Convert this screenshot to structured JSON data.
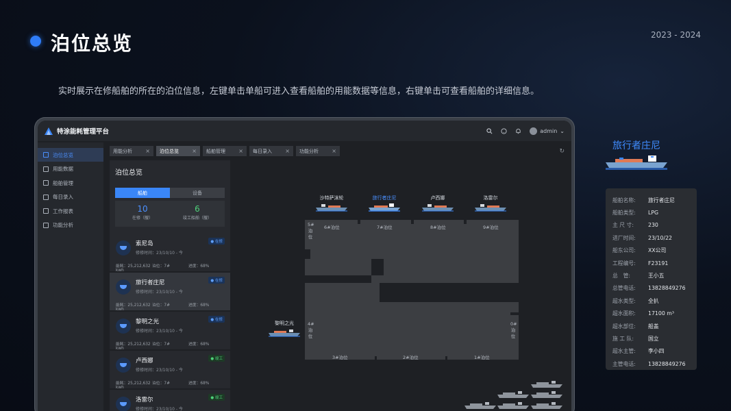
{
  "slide": {
    "title": "泊位总览",
    "year": "2023 - 2024",
    "description": "实时展示在修船舶的所在的泊位信息，左键单击单船可进入查看船舶的用能数据等信息，右键单击可查看船舶的详细信息。"
  },
  "app": {
    "name": "特涂能耗管理平台",
    "user": "admin"
  },
  "sidebar": {
    "items": [
      {
        "label": "泊位总览",
        "icon": "anchor-icon"
      },
      {
        "label": "用能数据",
        "icon": "chart-icon"
      },
      {
        "label": "船舶管理",
        "icon": "ship-icon"
      },
      {
        "label": "每日录入",
        "icon": "edit-icon"
      },
      {
        "label": "工作报表",
        "icon": "report-icon"
      },
      {
        "label": "功能分析",
        "icon": "monitor-icon"
      }
    ]
  },
  "tabs": [
    {
      "label": "用能分析"
    },
    {
      "label": "泊位总览"
    },
    {
      "label": "船舶管理"
    },
    {
      "label": "每日录入"
    },
    {
      "label": "功能分析"
    }
  ],
  "panel": {
    "title": "泊位总览",
    "seg_ship": "船舶",
    "seg_device": "设备",
    "stat_repair_value": "10",
    "stat_repair_label": "在修（艘）",
    "stat_done_value": "6",
    "stat_done_label": "竣工船舶（艘）",
    "ships": [
      {
        "name": "索尼岛",
        "time": "修修时间：23/10/10 - 今",
        "energy": "能耗：25,212,632 kwh",
        "berth": "泊位：7#",
        "progress": "进度：68%",
        "status": "在修"
      },
      {
        "name": "旅行者庄尼",
        "time": "修修时间：23/10/10 - 今",
        "energy": "能耗：25,212,632 kwh",
        "berth": "泊位：7#",
        "progress": "进度：68%",
        "status": "在修"
      },
      {
        "name": "黎明之光",
        "time": "修修时间：23/10/10 - 今",
        "energy": "能耗：25,212,632 kwh",
        "berth": "泊位：7#",
        "progress": "进度：68%",
        "status": "在修"
      },
      {
        "name": "卢西娜",
        "time": "修修时间：23/10/10 - 今",
        "energy": "能耗：25,212,632 kwh",
        "berth": "泊位：7#",
        "progress": "进度：68%",
        "status": "竣工"
      },
      {
        "name": "洛雷尔",
        "time": "修修时间：23/10/10 - 今",
        "energy": "能耗：25,212,632 kwh",
        "berth": "泊位：7#",
        "progress": "进度：68%",
        "status": "竣工"
      }
    ]
  },
  "map": {
    "top_ships": [
      "沙特萨沫轮",
      "旅行者庄尼",
      "卢西娜",
      "洛雷尔"
    ],
    "top_berths": [
      "6#泊位",
      "7#泊位",
      "8#泊位",
      "9#泊位"
    ],
    "bottom_berths": [
      "3#泊位",
      "2#泊位",
      "1#泊位"
    ],
    "left_berth_5": "5#泊位",
    "left_berth_4": "4#泊位",
    "right_berth_0": "0#泊位",
    "side_ship": "黎明之光"
  },
  "detail": {
    "title": "旅行者庄尼",
    "rows": [
      {
        "k": "船舶名称:",
        "v": "旅行者庄尼"
      },
      {
        "k": "船舶类型:",
        "v": "LPG"
      },
      {
        "k": "主 尺 寸:",
        "v": "230"
      },
      {
        "k": "进厂时间:",
        "v": "23/10/22"
      },
      {
        "k": "船东公司:",
        "v": "XX公司"
      },
      {
        "k": "工程编号:",
        "v": "F23191"
      },
      {
        "k": "总　管:",
        "v": "王小五"
      },
      {
        "k": "总管电话:",
        "v": "13828849276"
      },
      {
        "k": "超水类型:",
        "v": "全扒"
      },
      {
        "k": "超水面积:",
        "v": "17100 m³"
      },
      {
        "k": "超水部位:",
        "v": "船盖"
      },
      {
        "k": "施 工 队:",
        "v": "国立"
      },
      {
        "k": "超水主管:",
        "v": "李小四"
      },
      {
        "k": "主管电话:",
        "v": "13828849276"
      }
    ]
  },
  "colors": {
    "accent": "#3a86f7",
    "repair": "#5fa0ff",
    "done": "#4fd27a"
  }
}
